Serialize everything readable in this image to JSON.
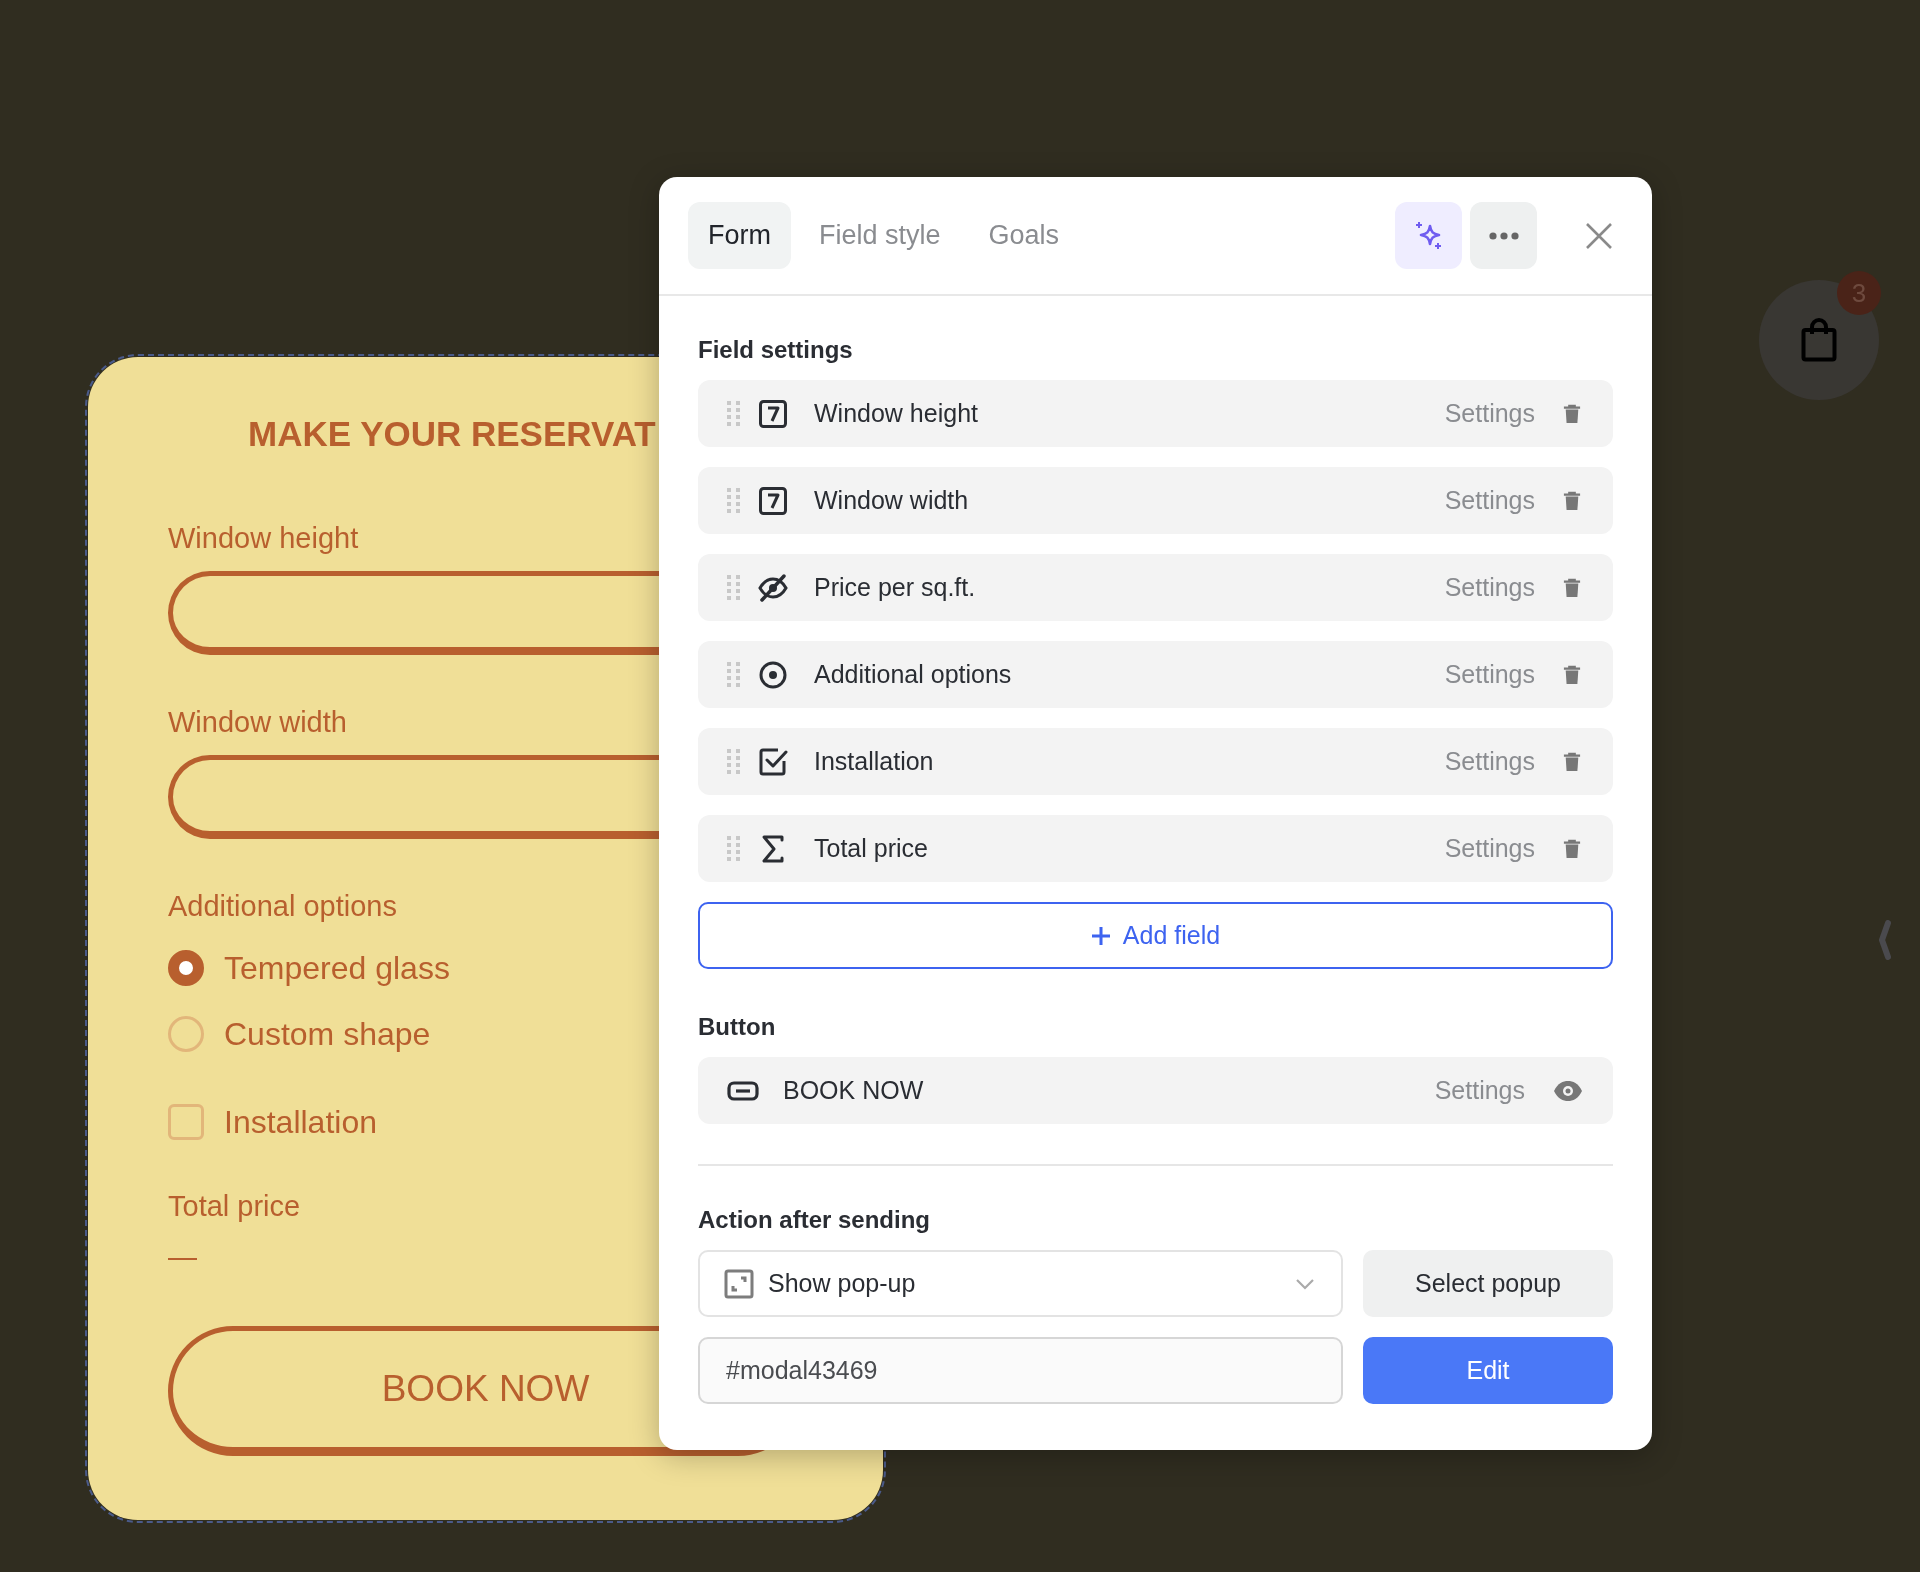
{
  "form_preview": {
    "title": "MAKE YOUR RESERVAT",
    "fields": [
      {
        "kind": "input",
        "label": "Window height"
      },
      {
        "kind": "input",
        "label": "Window width"
      },
      {
        "kind": "radio_group",
        "label": "Additional options",
        "options": [
          {
            "label": "Tempered glass",
            "selected": true
          },
          {
            "label": "Custom shape",
            "selected": false
          }
        ]
      },
      {
        "kind": "checkbox",
        "label": "Installation",
        "checked": false
      },
      {
        "kind": "total",
        "label": "Total price",
        "value": "—"
      }
    ],
    "button": "BOOK NOW"
  },
  "panel": {
    "tabs": [
      {
        "label": "Form",
        "selected": true
      },
      {
        "label": "Field style",
        "selected": false
      },
      {
        "label": "Goals",
        "selected": false
      }
    ],
    "field_settings": {
      "heading": "Field settings",
      "items": [
        {
          "kind": "number",
          "label": "Window height",
          "action": "Settings"
        },
        {
          "kind": "number",
          "label": "Window width",
          "action": "Settings"
        },
        {
          "kind": "hidden",
          "label": "Price per sq.ft.",
          "action": "Settings"
        },
        {
          "kind": "radio",
          "label": "Additional options",
          "action": "Settings"
        },
        {
          "kind": "checkbox",
          "label": "Installation",
          "action": "Settings"
        },
        {
          "kind": "formula",
          "label": "Total price",
          "action": "Settings"
        }
      ],
      "add_button": "Add field"
    },
    "button_section": {
      "heading": "Button",
      "item": {
        "label": "BOOK NOW",
        "action": "Settings",
        "visible": true
      }
    },
    "action_after_sending": {
      "heading": "Action after sending",
      "select": {
        "value": "Show pop-up"
      },
      "select_button": "Select popup",
      "target": {
        "value": "#modal43469"
      },
      "edit_button": "Edit"
    }
  },
  "cart": {
    "badge": "3"
  }
}
